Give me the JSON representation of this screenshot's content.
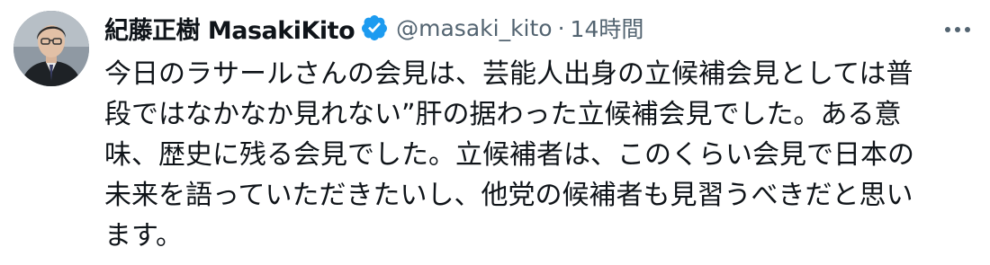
{
  "tweet": {
    "author": {
      "display_name": "紀藤正樹 MasakiKito",
      "handle": "@masaki_kito",
      "verified": true,
      "avatar_icon": "person-avatar"
    },
    "separator": "·",
    "timestamp": "14時間",
    "more_icon": "more-horizontal-icon",
    "text": "今日のラサールさんの会見は、芸能人出身の立候補会見としては普\n段ではなかなか見れない”肝の据わった立候補会見でした。ある意\n味、歴史に残る会見でした。立候補者は、このくらい会見で日本の\n未来を語っていただきたいし、他党の候補者も見習うべきだと思い\nます。"
  },
  "colors": {
    "text_primary": "#0f1419",
    "text_secondary": "#536471",
    "verified_blue": "#1d9bf0"
  }
}
